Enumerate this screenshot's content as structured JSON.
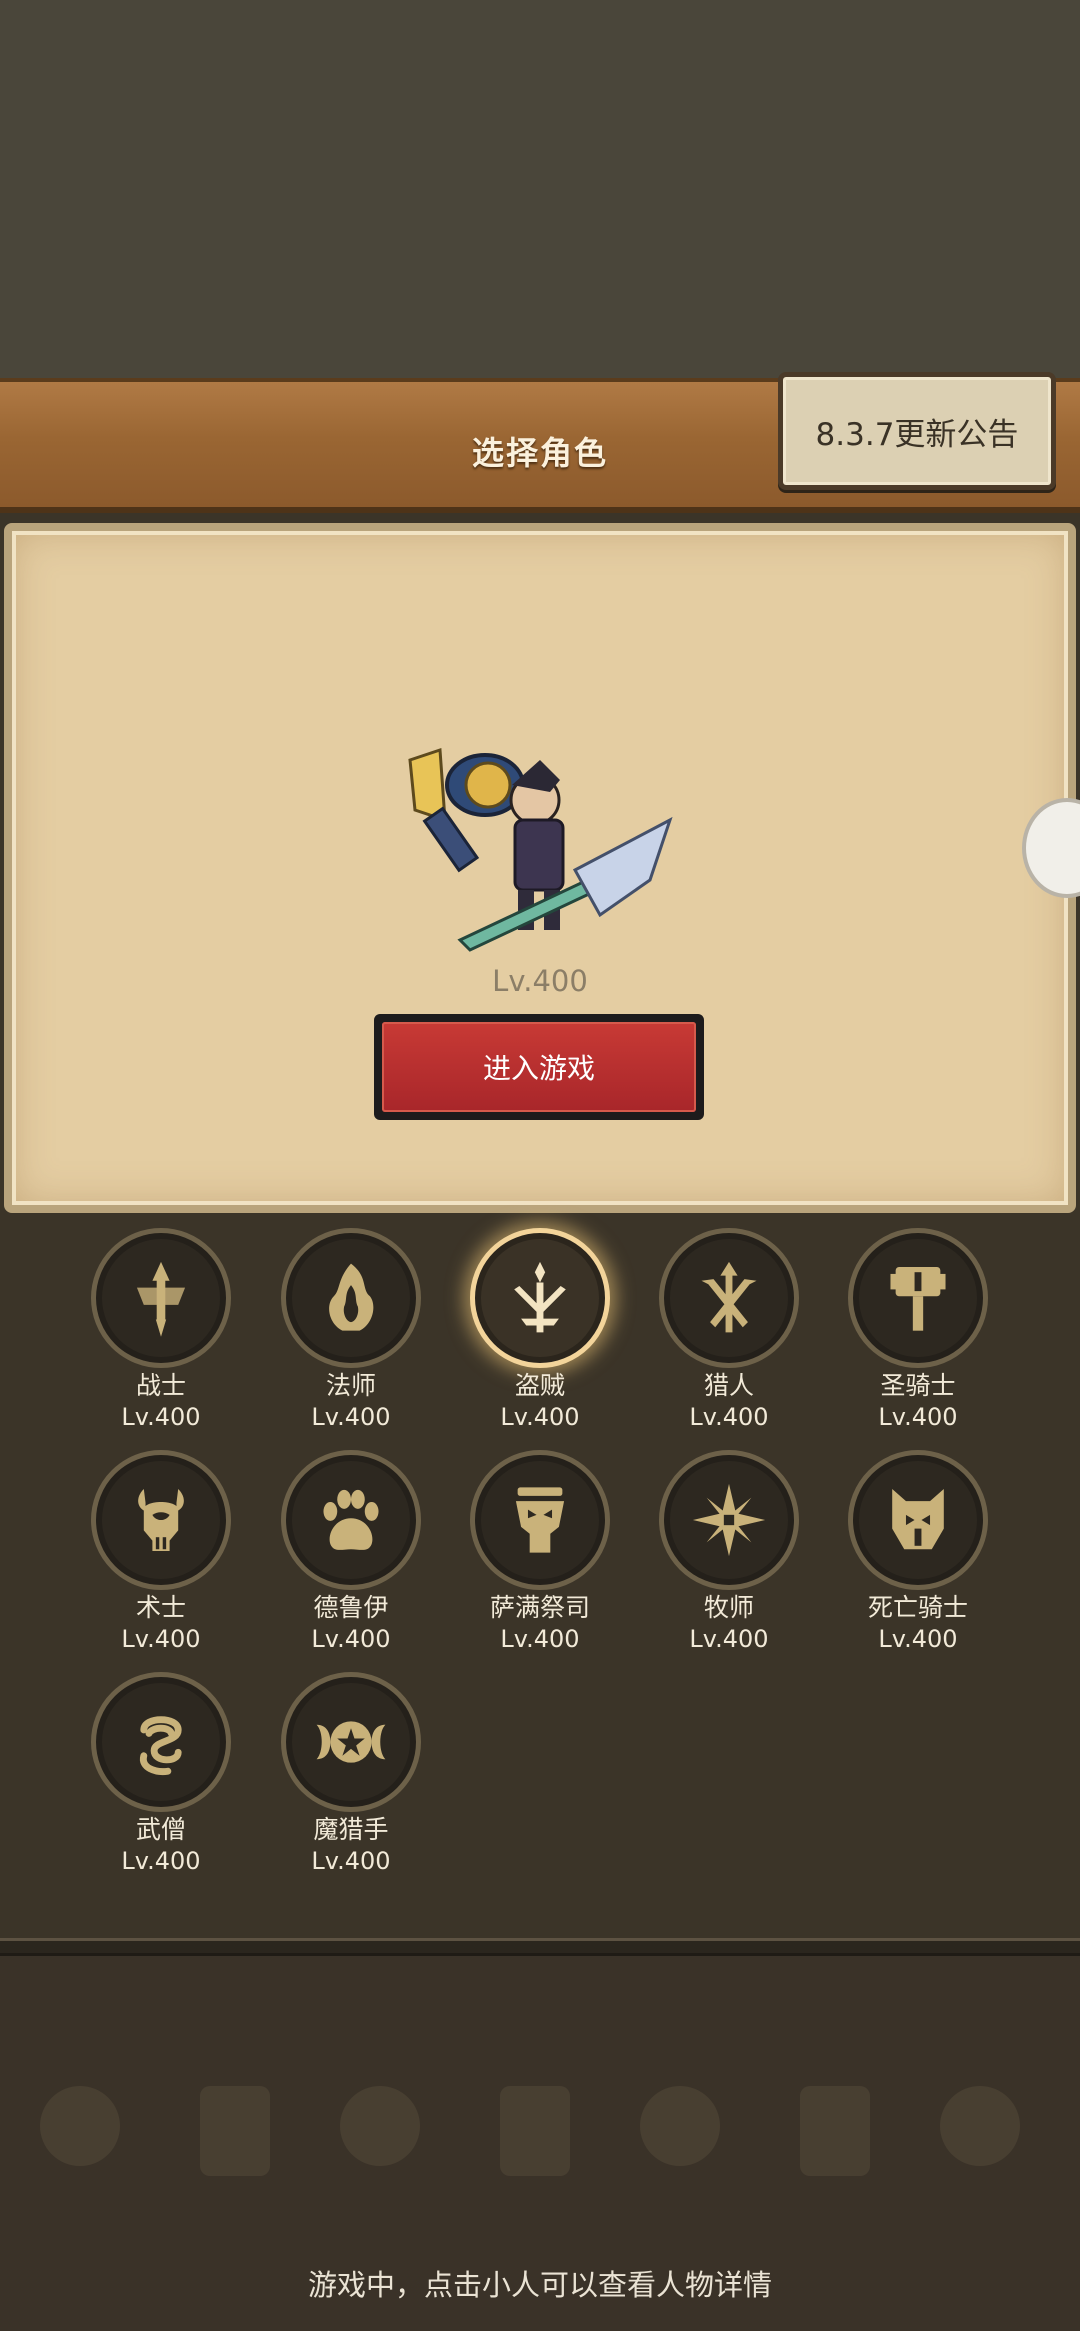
{
  "header": {
    "title": "选择角色",
    "notice_label": "8.3.7更新公告"
  },
  "hero": {
    "level": "Lv.400",
    "enter_label": "进入游戏"
  },
  "classes": [
    {
      "name": "战士",
      "level": "Lv.400",
      "icon": "sword-emblem-icon",
      "selected": false
    },
    {
      "name": "法师",
      "level": "Lv.400",
      "icon": "flame-emblem-icon",
      "selected": false
    },
    {
      "name": "盗贼",
      "level": "Lv.400",
      "icon": "daggers-emblem-icon",
      "selected": true
    },
    {
      "name": "猎人",
      "level": "Lv.400",
      "icon": "arrows-emblem-icon",
      "selected": false
    },
    {
      "name": "圣骑士",
      "level": "Lv.400",
      "icon": "hammer-emblem-icon",
      "selected": false
    },
    {
      "name": "术士",
      "level": "Lv.400",
      "icon": "skull-emblem-icon",
      "selected": false
    },
    {
      "name": "德鲁伊",
      "level": "Lv.400",
      "icon": "paw-emblem-icon",
      "selected": false
    },
    {
      "name": "萨满祭司",
      "level": "Lv.400",
      "icon": "totem-emblem-icon",
      "selected": false
    },
    {
      "name": "牧师",
      "level": "Lv.400",
      "icon": "star-emblem-icon",
      "selected": false
    },
    {
      "name": "死亡骑士",
      "level": "Lv.400",
      "icon": "helm-emblem-icon",
      "selected": false
    },
    {
      "name": "武僧",
      "level": "Lv.400",
      "icon": "swirl-emblem-icon",
      "selected": false
    },
    {
      "name": "魔猎手",
      "level": "Lv.400",
      "icon": "demon-star-emblem-icon",
      "selected": false
    }
  ],
  "hint": "游戏中，点击小人可以查看人物详情",
  "colors": {
    "accent_gold": "#c9b27a",
    "enter_red": "#b8302e",
    "panel_parchment": "#e4cda2"
  }
}
